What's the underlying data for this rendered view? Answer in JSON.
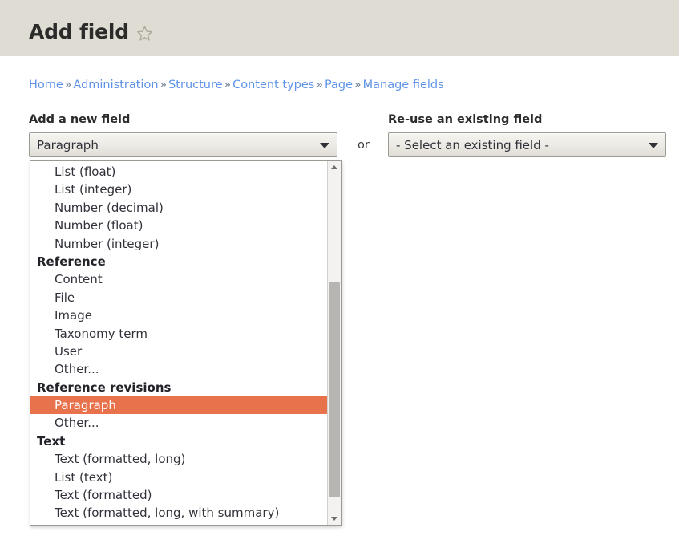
{
  "header": {
    "title": "Add field",
    "star_icon": "star-outline-icon",
    "background_color": "#dedcd3"
  },
  "breadcrumb": {
    "separator": "»",
    "items": [
      {
        "label": "Home"
      },
      {
        "label": "Administration"
      },
      {
        "label": "Structure"
      },
      {
        "label": "Content types"
      },
      {
        "label": "Page"
      },
      {
        "label": "Manage fields"
      }
    ]
  },
  "form": {
    "or_label": "or",
    "new_field": {
      "label": "Add a new field",
      "selected_value": "Paragraph",
      "arrow_icon": "chevron-down-icon"
    },
    "existing_field": {
      "label": "Re-use an existing field",
      "selected_value": "- Select an existing field -",
      "arrow_icon": "chevron-down-icon"
    }
  },
  "dropdown": {
    "selected_option": "Paragraph",
    "highlight_color": "#e8724c",
    "scrollbar": {
      "up_arrow_icon": "scroll-up-arrow-icon",
      "down_arrow_icon": "scroll-down-arrow-icon"
    },
    "options": [
      {
        "label": "List (float)",
        "type": "option"
      },
      {
        "label": "List (integer)",
        "type": "option"
      },
      {
        "label": "Number (decimal)",
        "type": "option"
      },
      {
        "label": "Number (float)",
        "type": "option"
      },
      {
        "label": "Number (integer)",
        "type": "option"
      },
      {
        "label": "Reference",
        "type": "group"
      },
      {
        "label": "Content",
        "type": "option"
      },
      {
        "label": "File",
        "type": "option"
      },
      {
        "label": "Image",
        "type": "option"
      },
      {
        "label": "Taxonomy term",
        "type": "option"
      },
      {
        "label": "User",
        "type": "option"
      },
      {
        "label": "Other...",
        "type": "option"
      },
      {
        "label": "Reference revisions",
        "type": "group"
      },
      {
        "label": "Paragraph",
        "type": "option",
        "selected": true
      },
      {
        "label": "Other...",
        "type": "option"
      },
      {
        "label": "Text",
        "type": "group"
      },
      {
        "label": "Text (formatted, long)",
        "type": "option"
      },
      {
        "label": "List (text)",
        "type": "option"
      },
      {
        "label": "Text (formatted)",
        "type": "option"
      },
      {
        "label": "Text (formatted, long, with summary)",
        "type": "option"
      }
    ]
  }
}
